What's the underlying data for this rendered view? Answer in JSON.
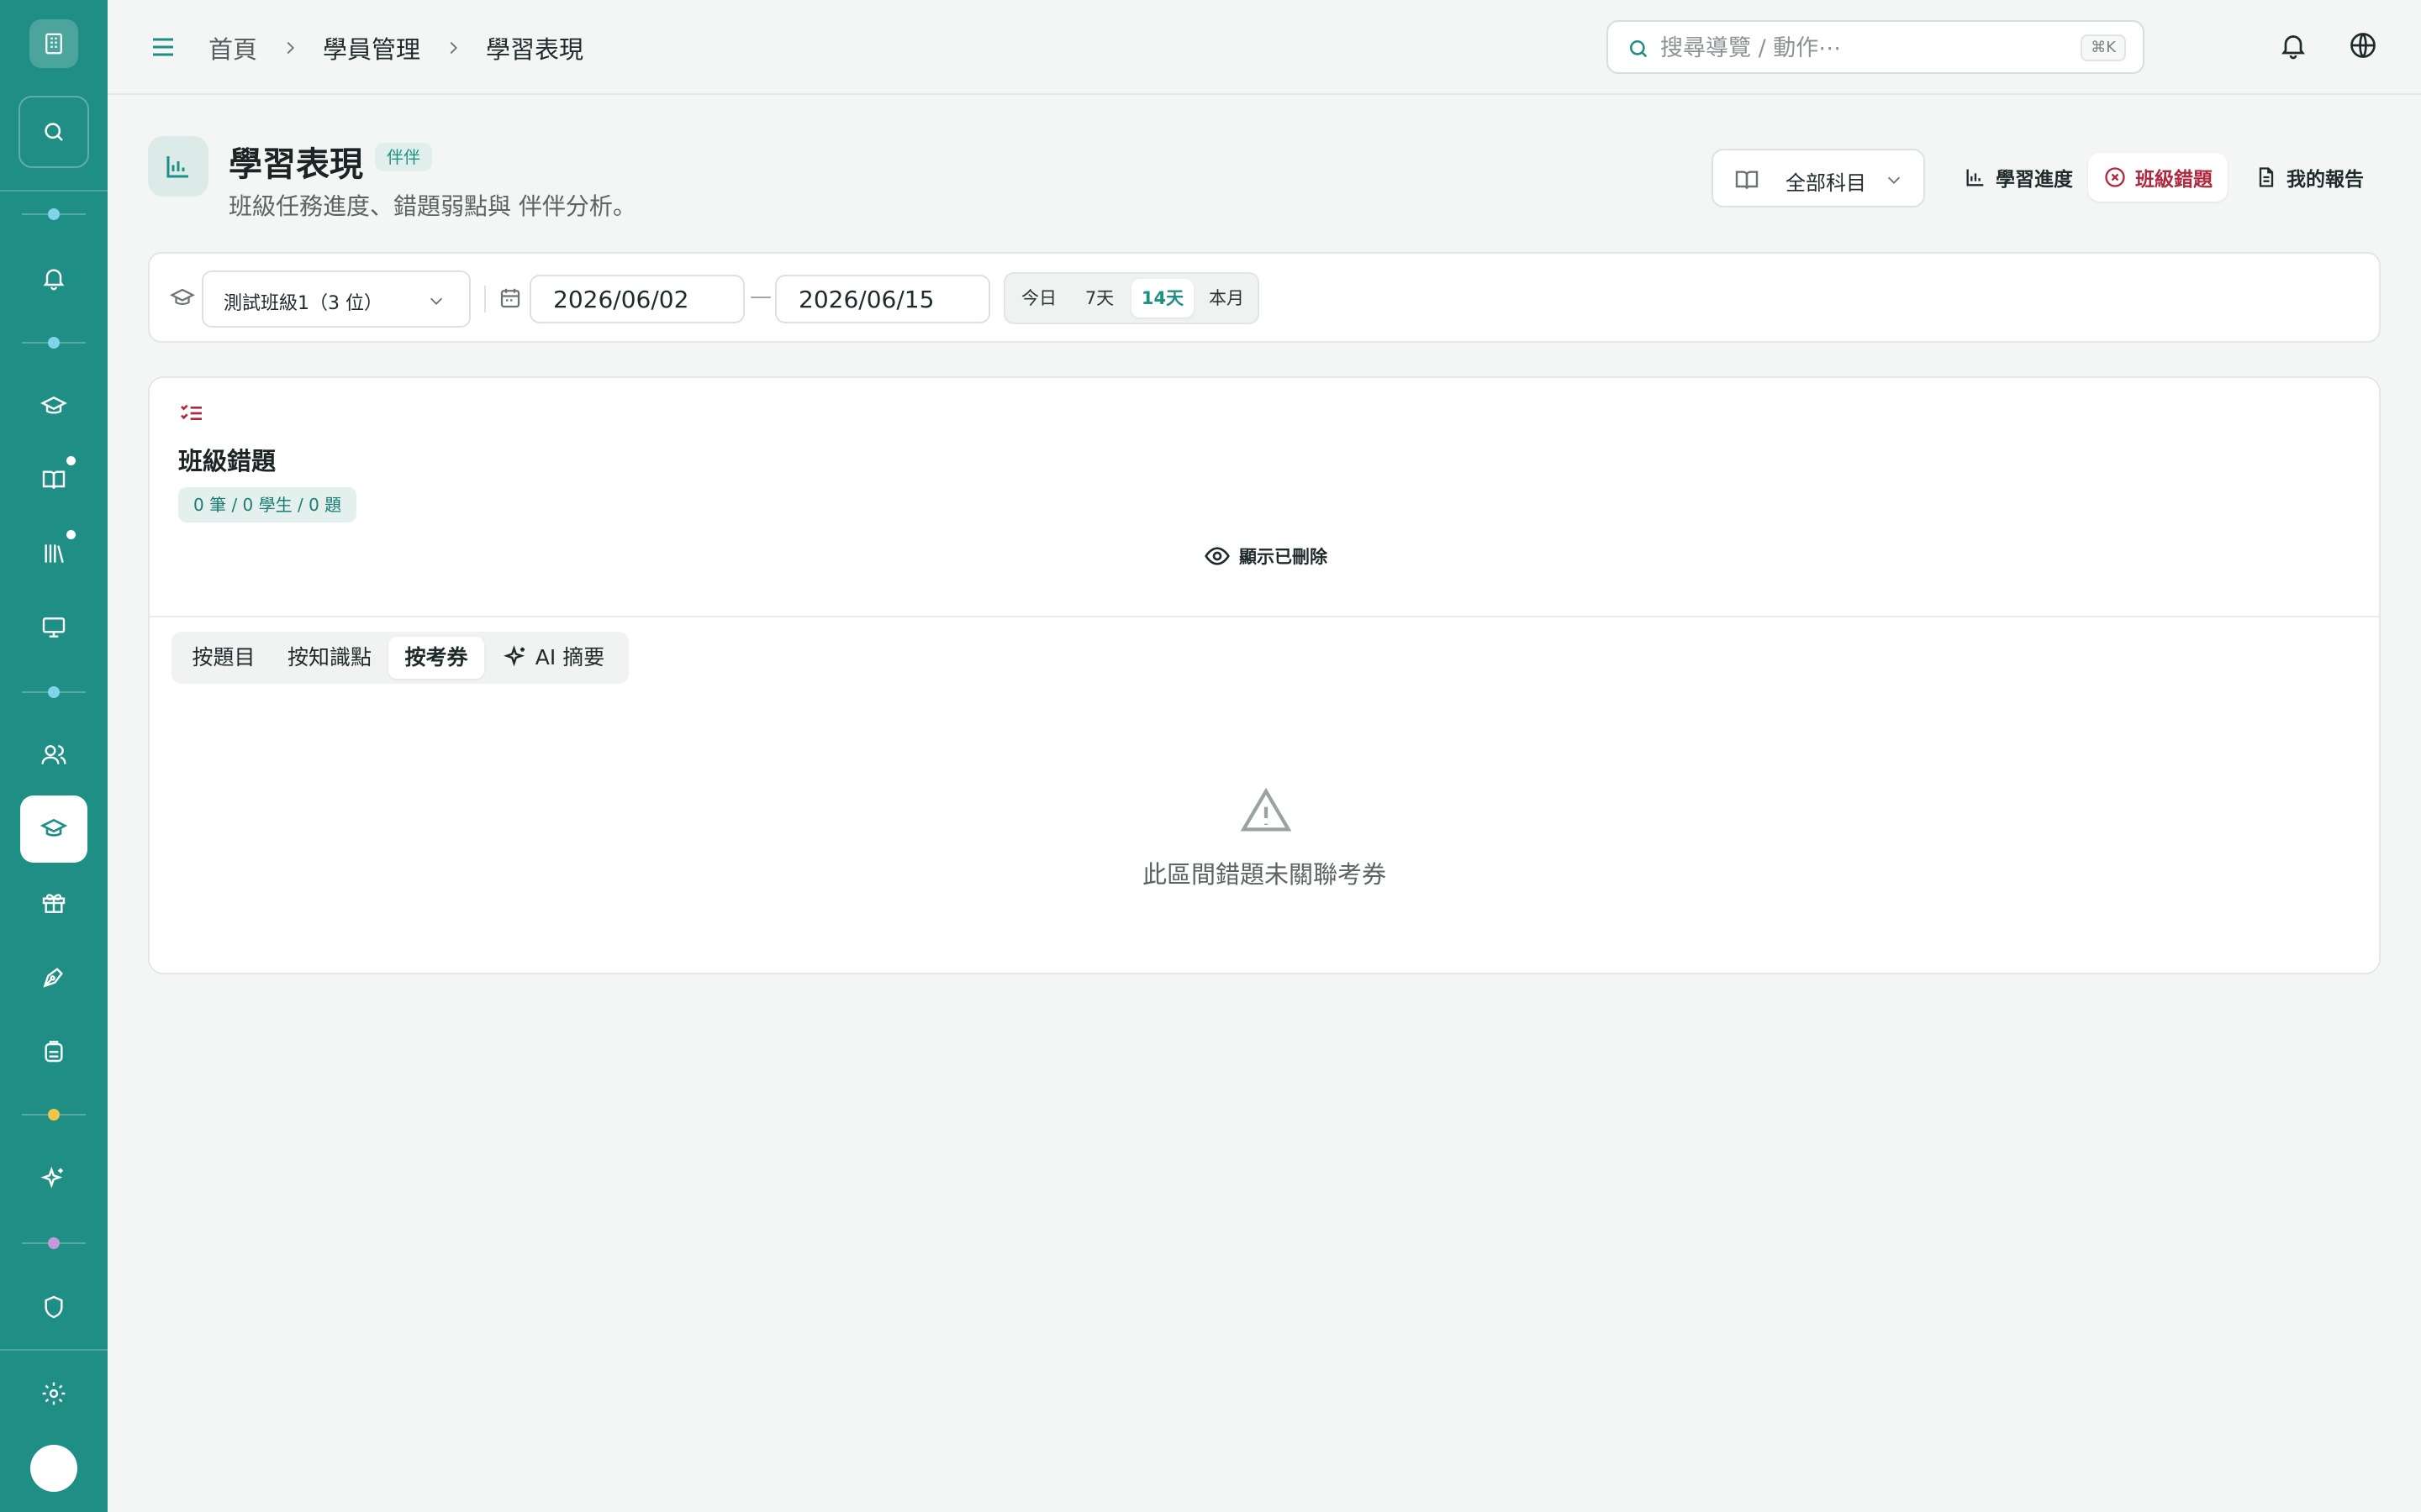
{
  "topbar": {
    "breadcrumb": [
      "首頁",
      "學員管理",
      "學習表現"
    ],
    "search_placeholder": "搜尋導覽 / 動作⋯",
    "search_shortcut": "⌘K"
  },
  "header": {
    "title": "學習表現",
    "badge": "伴伴",
    "subtitle": "班級任務進度、錯題弱點與 伴伴分析。",
    "subject_select": "全部科目",
    "views": [
      {
        "label": "學習進度",
        "icon": "bar-chart-icon",
        "active": false
      },
      {
        "label": "班級錯題",
        "icon": "x-circle-icon",
        "active": true
      },
      {
        "label": "我的報告",
        "icon": "document-icon",
        "active": false
      }
    ]
  },
  "filters": {
    "class_select": "測試班級1（3 位）",
    "date_from": "2026/06/02",
    "date_to": "2026/06/15",
    "date_separator": "—",
    "ranges": [
      {
        "label": "今日",
        "active": false
      },
      {
        "label": "7天",
        "active": false
      },
      {
        "label": "14天",
        "active": true
      },
      {
        "label": "本月",
        "active": false
      }
    ]
  },
  "card": {
    "title": "班級錯題",
    "stats": "0 筆 / 0 學生 / 0 題",
    "show_deleted": "顯示已刪除",
    "tabs": [
      {
        "label": "按題目",
        "active": false
      },
      {
        "label": "按知識點",
        "active": false
      },
      {
        "label": "按考券",
        "active": true
      },
      {
        "label": "AI 摘要",
        "active": false,
        "icon": "sparkles-icon"
      }
    ],
    "empty_message": "此區間錯題未關聯考券"
  },
  "colors": {
    "sidebar": "#1f8f85",
    "accent": "#1f8f85",
    "danger": "#b0283d",
    "background": "#f3f6f5"
  }
}
